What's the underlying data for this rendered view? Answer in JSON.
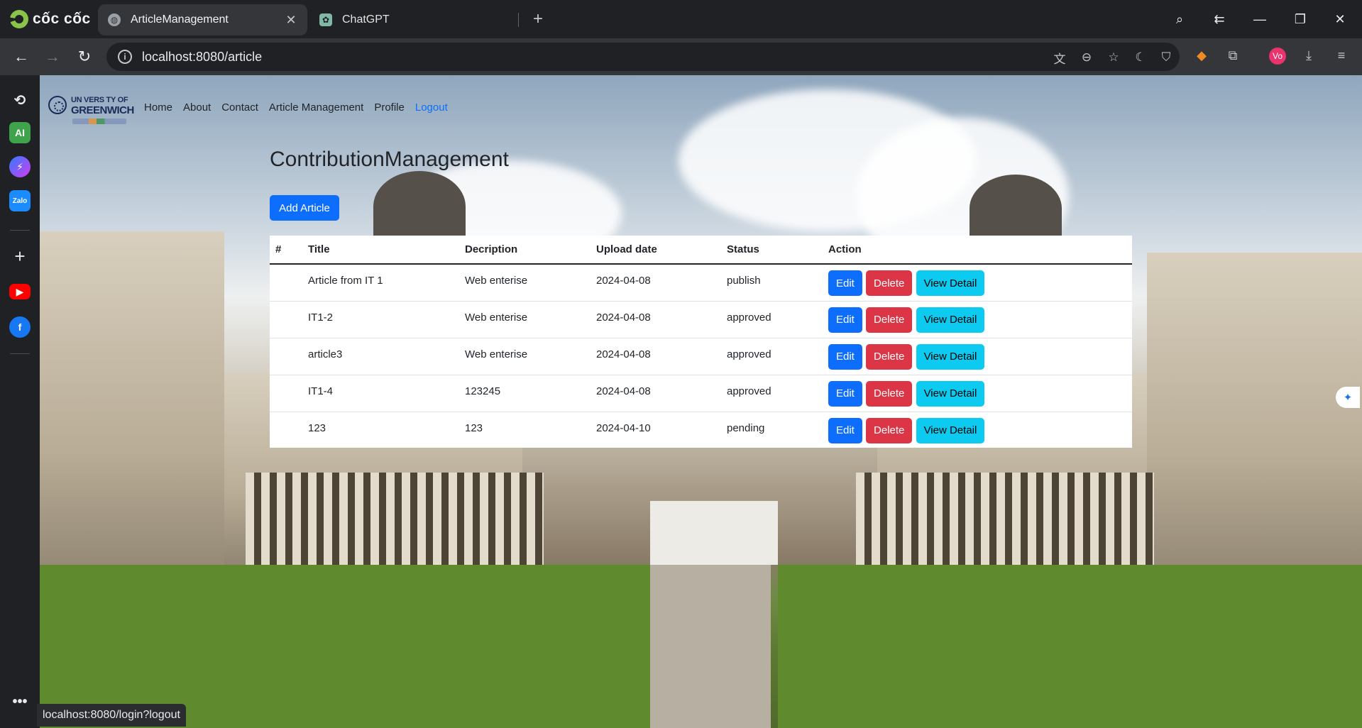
{
  "browser": {
    "brand_name": "cốc cốc",
    "tabs": [
      {
        "title": "ArticleManagement",
        "active": true,
        "icon": "globe-icon"
      },
      {
        "title": "ChatGPT",
        "active": false,
        "icon": "chatgpt-icon"
      }
    ],
    "url": "localhost:8080/article",
    "status_url": "localhost:8080/login?logout",
    "profile_initials": "Vo"
  },
  "sidebar": {
    "items": [
      {
        "name": "history",
        "icon": "history-icon"
      },
      {
        "name": "ai",
        "label": "AI",
        "icon": "ai-icon"
      },
      {
        "name": "messenger",
        "icon": "messenger-icon"
      },
      {
        "name": "zalo",
        "label": "Zalo",
        "icon": "zalo-icon"
      },
      {
        "name": "add",
        "icon": "plus-icon"
      },
      {
        "name": "youtube",
        "icon": "youtube-icon"
      },
      {
        "name": "facebook",
        "icon": "facebook-icon"
      },
      {
        "name": "more",
        "icon": "more-icon"
      }
    ]
  },
  "site": {
    "logo_line1": "UN VERS TY OF",
    "logo_line2": "GREENWICH",
    "nav": [
      "Home",
      "About",
      "Contact",
      "Article Management",
      "Profile",
      "Logout"
    ]
  },
  "page": {
    "title": "ContributionManagement",
    "add_button": "Add Article"
  },
  "table": {
    "headers": [
      "#",
      "Title",
      "Decription",
      "Upload date",
      "Status",
      "Action"
    ],
    "rows": [
      {
        "num": "",
        "title": "Article from IT 1",
        "description": "Web enterise",
        "upload_date": "2024-04-08",
        "status": "publish"
      },
      {
        "num": "",
        "title": "IT1-2",
        "description": "Web enterise",
        "upload_date": "2024-04-08",
        "status": "approved"
      },
      {
        "num": "",
        "title": "article3",
        "description": "Web enterise",
        "upload_date": "2024-04-08",
        "status": "approved"
      },
      {
        "num": "",
        "title": "IT1-4",
        "description": "123245",
        "upload_date": "2024-04-08",
        "status": "approved"
      },
      {
        "num": "",
        "title": "123",
        "description": "123",
        "upload_date": "2024-04-10",
        "status": "pending"
      }
    ],
    "actions": {
      "edit": "Edit",
      "delete": "Delete",
      "view": "View Detail"
    }
  },
  "colors": {
    "primary": "#0d6efd",
    "danger": "#dc3545",
    "info": "#0dcaf0",
    "browser_bg": "#202124"
  }
}
